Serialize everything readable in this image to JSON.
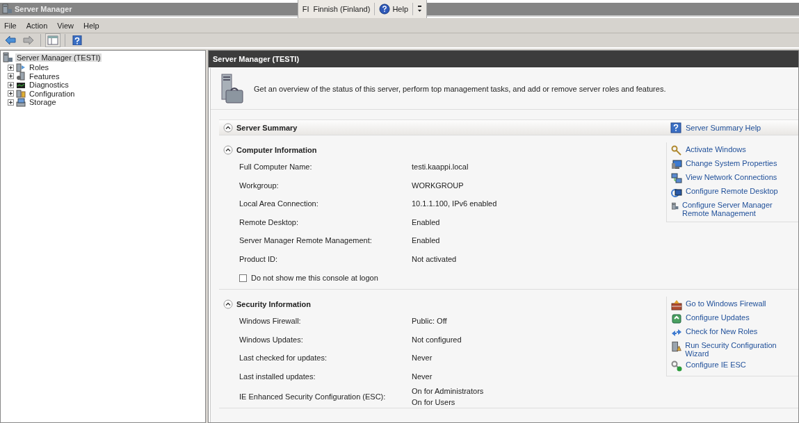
{
  "window": {
    "title": "Server Manager"
  },
  "language_bar": {
    "code": "FI",
    "language": "Finnish (Finland)",
    "help": "Help"
  },
  "menu": [
    "File",
    "Action",
    "View",
    "Help"
  ],
  "tree": {
    "label": "Server Manager (TESTI)",
    "selected": true,
    "children": [
      {
        "label": "Roles",
        "expanded": false
      },
      {
        "label": "Features",
        "expanded": false
      },
      {
        "label": "Diagnostics",
        "expanded": false
      },
      {
        "label": "Configuration",
        "expanded": false
      },
      {
        "label": "Storage",
        "expanded": false
      }
    ]
  },
  "content": {
    "title": "Server Manager (TESTI)",
    "description": "Get an overview of the status of this server, perform top management tasks, and add or remove server roles and features.",
    "sections": [
      {
        "title": "Server Summary",
        "expanded": true,
        "help_link": "Server Summary Help",
        "subsections": [
          {
            "title": "Computer Information",
            "expanded": true,
            "rows": [
              {
                "label": "Full Computer Name:",
                "value": "testi.kaappi.local"
              },
              {
                "label": "Workgroup:",
                "value": "WORKGROUP"
              },
              {
                "label": "Local Area Connection:",
                "value": "10.1.1.100, IPv6 enabled"
              },
              {
                "label": "Remote Desktop:",
                "value": "Enabled"
              },
              {
                "label": "Server Manager Remote Management:",
                "value": "Enabled"
              },
              {
                "label": "Product ID:",
                "value": "Not activated"
              }
            ],
            "checkbox": {
              "label": "Do not show me this console at logon",
              "checked": false
            },
            "tasks": [
              "Activate Windows",
              "Change System Properties",
              "View Network Connections",
              "Configure Remote Desktop",
              "Configure Server Manager Remote Management"
            ]
          },
          {
            "title": "Security Information",
            "expanded": true,
            "rows": [
              {
                "label": "Windows Firewall:",
                "value": "Public: Off"
              },
              {
                "label": "Windows Updates:",
                "value": "Not configured"
              },
              {
                "label": "Last checked for updates:",
                "value": "Never"
              },
              {
                "label": "Last installed updates:",
                "value": "Never"
              },
              {
                "label": "IE Enhanced Security Configuration (ESC):",
                "value": "On for Administrators\nOn for Users"
              }
            ],
            "tasks": [
              "Go to Windows Firewall",
              "Configure Updates",
              "Check for New Roles",
              "Run Security Configuration Wizard",
              "Configure IE ESC"
            ]
          }
        ]
      }
    ]
  }
}
